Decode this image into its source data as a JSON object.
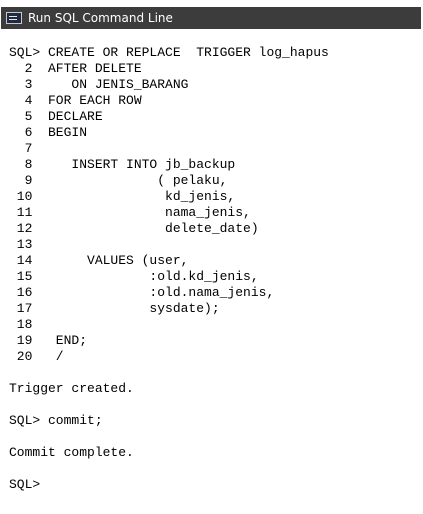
{
  "window": {
    "title": "Run SQL Command Line",
    "icon": "sqlplus-app-icon"
  },
  "console": {
    "lines": [
      "SQL> CREATE OR REPLACE  TRIGGER log_hapus",
      "  2  AFTER DELETE",
      "  3     ON JENIS_BARANG",
      "  4  FOR EACH ROW",
      "  5  DECLARE",
      "  6  BEGIN",
      "  7",
      "  8     INSERT INTO jb_backup",
      "  9                ( pelaku,",
      " 10                 kd_jenis,",
      " 11                 nama_jenis,",
      " 12                 delete_date)",
      " 13",
      " 14       VALUES (user,",
      " 15               :old.kd_jenis,",
      " 16               :old.nama_jenis,",
      " 17               sysdate);",
      " 18",
      " 19   END;",
      " 20   /",
      "",
      "Trigger created.",
      "",
      "SQL> commit;",
      "",
      "Commit complete.",
      "",
      "SQL> "
    ]
  }
}
